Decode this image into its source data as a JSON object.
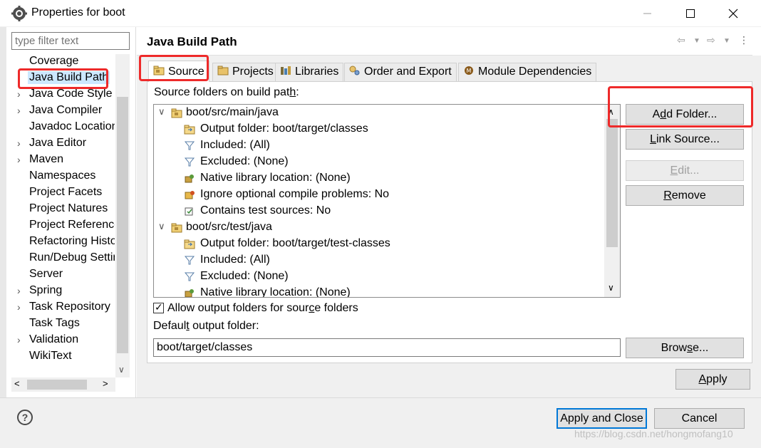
{
  "window": {
    "title": "Properties for boot",
    "minimize_icon": "minimize-icon",
    "maximize_icon": "maximize-icon",
    "close_icon": "close-icon"
  },
  "filter": {
    "placeholder": "type filter text"
  },
  "nav": {
    "items": [
      {
        "label": "Coverage",
        "expandable": false
      },
      {
        "label": "Java Build Path",
        "expandable": false,
        "selected": true
      },
      {
        "label": "Java Code Style",
        "expandable": true
      },
      {
        "label": "Java Compiler",
        "expandable": true
      },
      {
        "label": "Javadoc Location",
        "expandable": false
      },
      {
        "label": "Java Editor",
        "expandable": true
      },
      {
        "label": "Maven",
        "expandable": true
      },
      {
        "label": "Namespaces",
        "expandable": false
      },
      {
        "label": "Project Facets",
        "expandable": false
      },
      {
        "label": "Project Natures",
        "expandable": false
      },
      {
        "label": "Project References",
        "expandable": false
      },
      {
        "label": "Refactoring History",
        "expandable": false
      },
      {
        "label": "Run/Debug Settings",
        "expandable": false
      },
      {
        "label": "Server",
        "expandable": false
      },
      {
        "label": "Spring",
        "expandable": true
      },
      {
        "label": "Task Repository",
        "expandable": true
      },
      {
        "label": "Task Tags",
        "expandable": false
      },
      {
        "label": "Validation",
        "expandable": true
      },
      {
        "label": "WikiText",
        "expandable": false
      }
    ]
  },
  "page": {
    "title": "Java Build Path",
    "tabs": [
      {
        "label": "Source",
        "icon": "source-folder-icon",
        "active": true
      },
      {
        "label": "Projects",
        "icon": "projects-icon"
      },
      {
        "label": "Libraries",
        "icon": "libraries-icon"
      },
      {
        "label": "Order and Export",
        "icon": "order-export-icon"
      },
      {
        "label": "Module Dependencies",
        "icon": "module-icon"
      }
    ],
    "section_label": "Source folders on build path:",
    "tree": [
      {
        "label": "boot/src/main/java",
        "level": 0,
        "expanded": true,
        "icon": "package-folder-icon"
      },
      {
        "label": "Output folder: boot/target/classes",
        "level": 1,
        "icon": "output-folder-icon"
      },
      {
        "label": "Included: (All)",
        "level": 1,
        "icon": "filter-icon"
      },
      {
        "label": "Excluded: (None)",
        "level": 1,
        "icon": "filter-icon"
      },
      {
        "label": "Native library location: (None)",
        "level": 1,
        "icon": "native-library-icon"
      },
      {
        "label": "Ignore optional compile problems: No",
        "level": 1,
        "icon": "ignore-problems-icon"
      },
      {
        "label": "Contains test sources: No",
        "level": 1,
        "icon": "test-sources-icon"
      },
      {
        "label": "boot/src/test/java",
        "level": 0,
        "expanded": true,
        "icon": "package-folder-icon"
      },
      {
        "label": "Output folder: boot/target/test-classes",
        "level": 1,
        "icon": "output-folder-icon"
      },
      {
        "label": "Included: (All)",
        "level": 1,
        "icon": "filter-icon"
      },
      {
        "label": "Excluded: (None)",
        "level": 1,
        "icon": "filter-icon"
      },
      {
        "label": "Native library location: (None)",
        "level": 1,
        "icon": "native-library-icon"
      }
    ],
    "buttons": {
      "add_folder": "Add Folder...",
      "link_source": "Link Source...",
      "edit": "Edit...",
      "remove": "Remove",
      "browse": "Browse...",
      "apply": "Apply"
    },
    "allow_output_folders": {
      "label": "Allow output folders for source folders",
      "checked": true
    },
    "default_output_label": "Default output folder:",
    "default_output_value": "boot/target/classes"
  },
  "footer": {
    "help_icon": "help-icon",
    "help_glyph": "?",
    "apply_and_close": "Apply and Close",
    "cancel": "Cancel",
    "watermark": "https://blog.csdn.net/hongmofang10"
  },
  "colors": {
    "selection": "#cce8ff",
    "annotation_red": "#ee2a2a",
    "default_button_border": "#0078d7"
  }
}
